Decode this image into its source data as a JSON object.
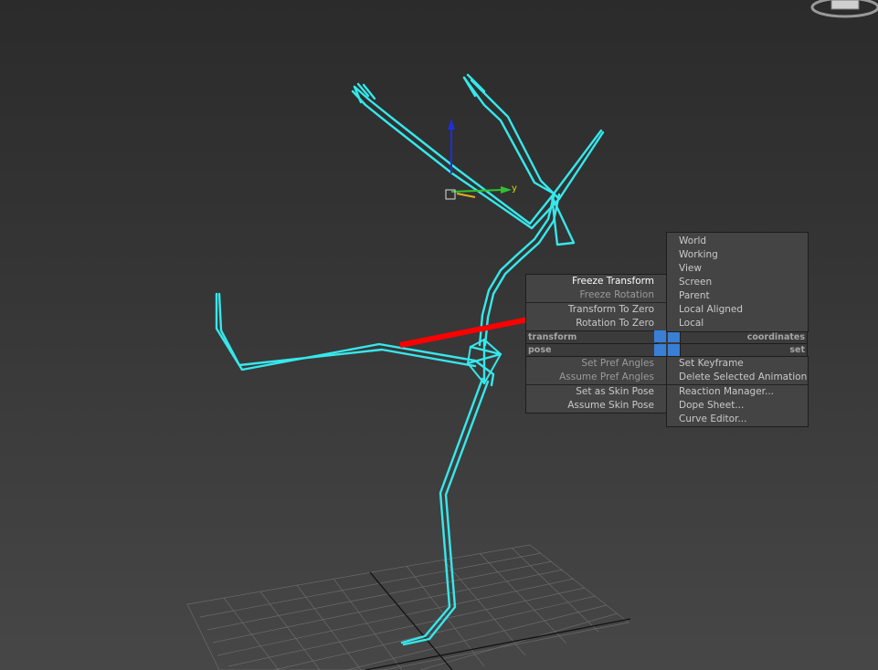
{
  "viewport": {
    "gizmo_axis_label": "y"
  },
  "quad_menu": {
    "left_top": {
      "header": "transform",
      "items": [
        {
          "label": "Freeze Transform",
          "state": "highlighted"
        },
        {
          "label": "Freeze Rotation",
          "state": "disabled"
        },
        {
          "label": "Transform To Zero",
          "state": "normal"
        },
        {
          "label": "Rotation To Zero",
          "state": "normal"
        }
      ]
    },
    "left_bottom": {
      "header": "pose",
      "items": [
        {
          "label": "Set Pref Angles",
          "state": "disabled"
        },
        {
          "label": "Assume Pref Angles",
          "state": "disabled"
        },
        {
          "label": "Set as Skin Pose",
          "state": "normal"
        },
        {
          "label": "Assume Skin Pose",
          "state": "normal"
        }
      ]
    },
    "right_top": {
      "header": "coordinates",
      "items": [
        {
          "label": "World",
          "state": "normal"
        },
        {
          "label": "Working",
          "state": "normal"
        },
        {
          "label": "View",
          "state": "normal"
        },
        {
          "label": "Screen",
          "state": "normal"
        },
        {
          "label": "Parent",
          "state": "normal"
        },
        {
          "label": "Local Aligned",
          "state": "normal"
        },
        {
          "label": "Local",
          "state": "normal"
        }
      ]
    },
    "right_bottom": {
      "header": "set",
      "items": [
        {
          "label": "Set Keyframe",
          "state": "normal"
        },
        {
          "label": "Delete Selected Animation",
          "state": "normal"
        },
        {
          "label": "Reaction Manager...",
          "state": "normal"
        },
        {
          "label": "Dope Sheet...",
          "state": "normal"
        },
        {
          "label": "Curve Editor...",
          "state": "normal"
        }
      ]
    }
  },
  "colors": {
    "skeleton": "#36e8ec",
    "arrow": "#ff0000",
    "menu_bg": "#444444",
    "quad_center": "#3a7fd6"
  }
}
